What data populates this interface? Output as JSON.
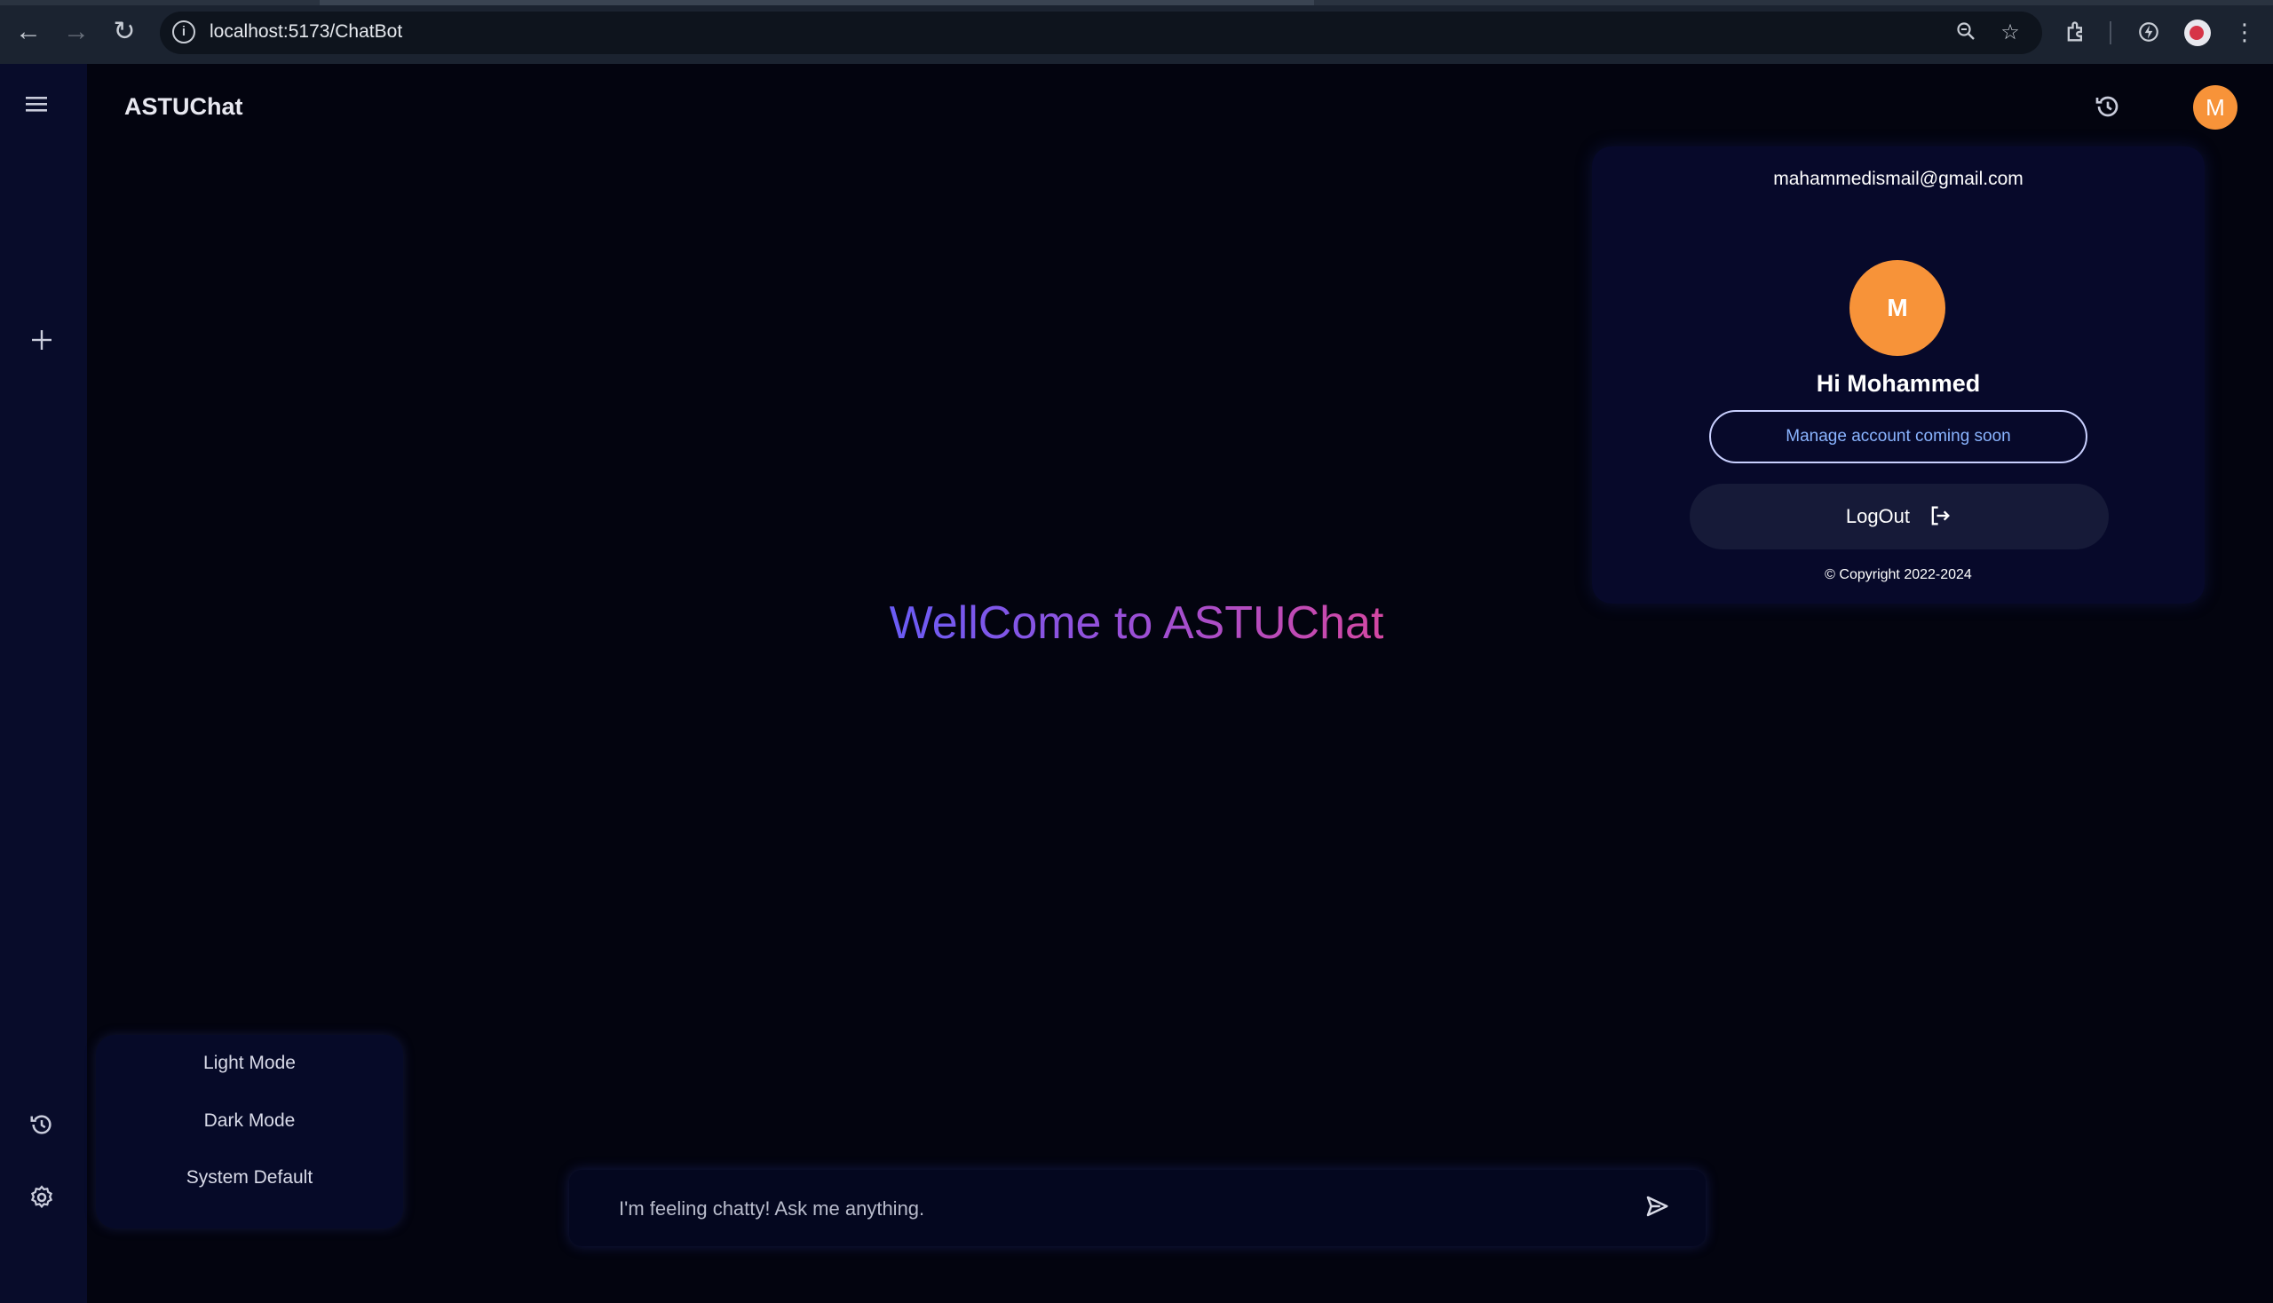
{
  "browser": {
    "url": "localhost:5173/ChatBot"
  },
  "app": {
    "title": "ASTUChat",
    "avatar_initial": "M"
  },
  "welcome": {
    "text": "WellCome to ASTUChat"
  },
  "profile": {
    "email": "mahammedismail@gmail.com",
    "avatar_initial": "M",
    "greeting": "Hi Mohammed",
    "manage_label": "Manage account coming soon",
    "logout_label": "LogOut",
    "copyright": "© Copyright 2022-2024"
  },
  "theme_menu": {
    "items": [
      "Light Mode",
      "Dark Mode",
      "System Default"
    ]
  },
  "chat": {
    "placeholder": "I'm feeling chatty! Ask me anything."
  },
  "colors": {
    "background": "#03040f",
    "sidebar": "#080c2a",
    "avatar": "#f79339",
    "gradient_start": "#6a5cf6",
    "gradient_end": "#d448a3"
  }
}
